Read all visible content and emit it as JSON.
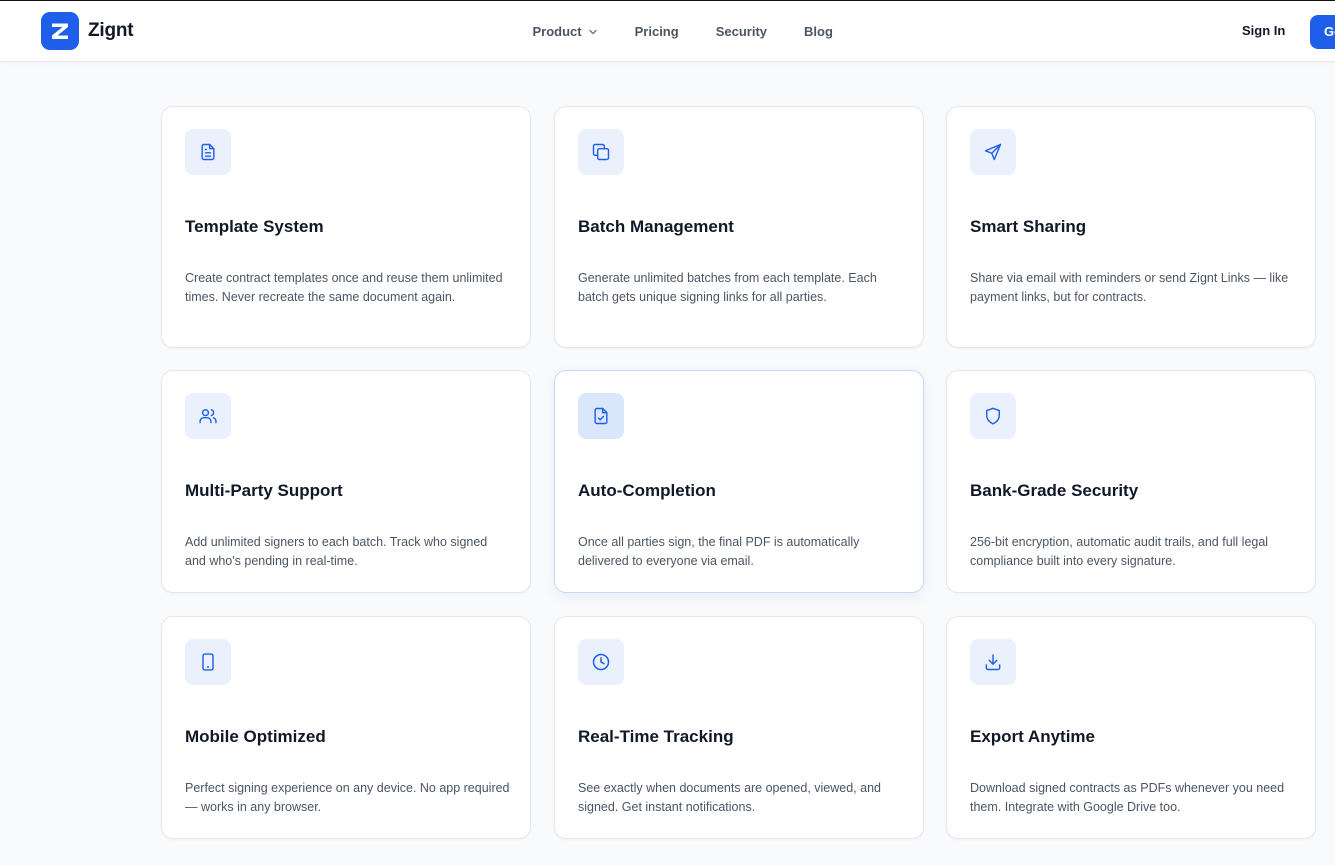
{
  "brand": {
    "name": "Zignt",
    "logo_letter": "Z",
    "accent": "#1f5ee8"
  },
  "nav": {
    "items": [
      {
        "label": "Product",
        "has_dropdown": true
      },
      {
        "label": "Pricing"
      },
      {
        "label": "Security"
      },
      {
        "label": "Blog"
      }
    ],
    "sign_in": "Sign In",
    "cta": "Get Started"
  },
  "features": [
    {
      "icon": "document-icon",
      "title": "Template System",
      "description": "Create contract templates once and reuse them unlimited times. Never recreate the same document again."
    },
    {
      "icon": "copy-icon",
      "title": "Batch Management",
      "description": "Generate unlimited batches from each template. Each batch gets unique signing links for all parties."
    },
    {
      "icon": "send-icon",
      "title": "Smart Sharing",
      "description": "Share via email with reminders or send Zignt Links — like payment links, but for contracts."
    },
    {
      "icon": "users-icon",
      "title": "Multi-Party Support",
      "description": "Add unlimited signers to each batch. Track who signed and who's pending in real-time."
    },
    {
      "icon": "file-check-icon",
      "title": "Auto-Completion",
      "description": "Once all parties sign, the final PDF is automatically delivered to everyone via email."
    },
    {
      "icon": "shield-icon",
      "title": "Bank-Grade Security",
      "description": "256-bit encryption, automatic audit trails, and full legal compliance built into every signature."
    },
    {
      "icon": "smartphone-icon",
      "title": "Mobile Optimized",
      "description": "Perfect signing experience on any device. No app required — works in any browser."
    },
    {
      "icon": "clock-icon",
      "title": "Real-Time Tracking",
      "description": "See exactly when documents are opened, viewed, and signed. Get instant notifications."
    },
    {
      "icon": "download-icon",
      "title": "Export Anytime",
      "description": "Download signed contracts as PDFs whenever you need them. Integrate with Google Drive too."
    }
  ]
}
